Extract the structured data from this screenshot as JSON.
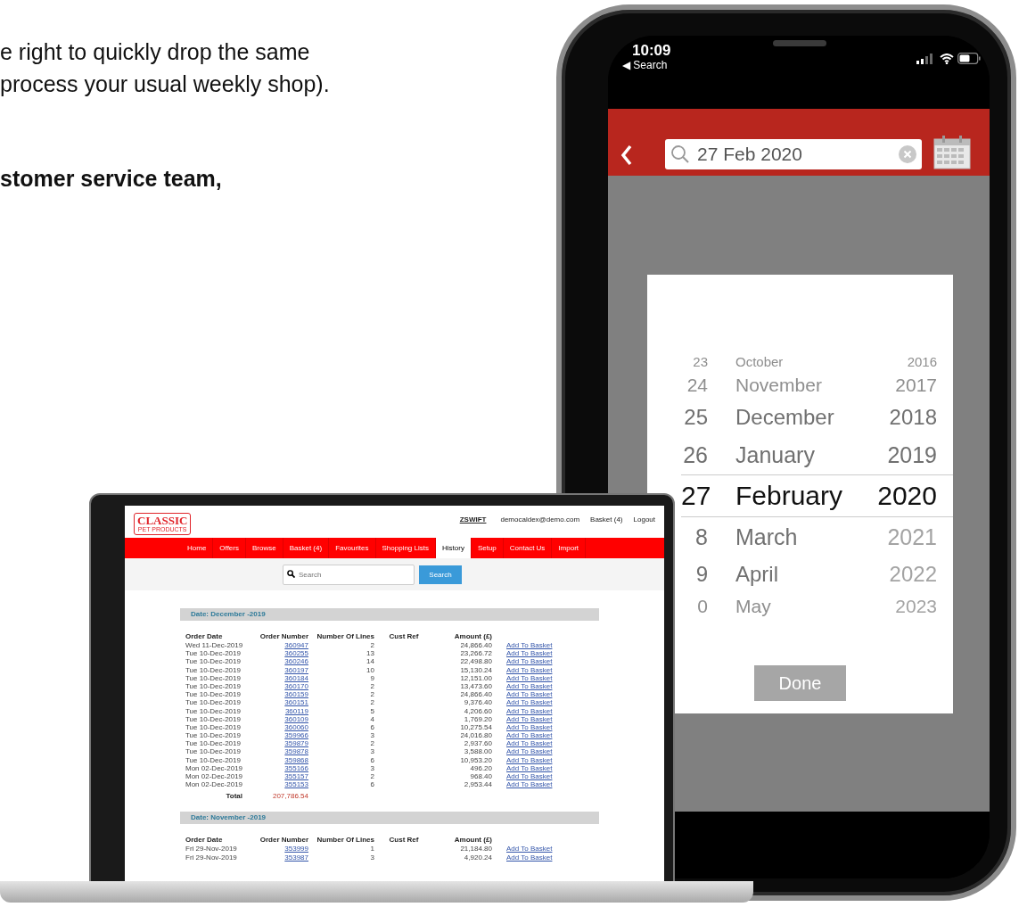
{
  "intro": {
    "lines": [
      "e right to quickly drop the same",
      "process your usual weekly shop)."
    ],
    "bold_line": "stomer service team,"
  },
  "laptop": {
    "logo": {
      "name": "CLASSIC",
      "tagline": "PET PRODUCTS"
    },
    "user": "ZSWIFT",
    "email": "democaldex@demo.com",
    "basket": "Basket (4)",
    "logout": "Logout",
    "nav": [
      {
        "label": "Home",
        "selected": false
      },
      {
        "label": "Offers",
        "selected": false
      },
      {
        "label": "Browse",
        "selected": false
      },
      {
        "label": "Basket (4)",
        "selected": false
      },
      {
        "label": "Favourites",
        "selected": false
      },
      {
        "label": "Shopping Lists",
        "selected": false
      },
      {
        "label": "History",
        "selected": true
      },
      {
        "label": "Setup",
        "selected": false
      },
      {
        "label": "Contact Us",
        "selected": false
      },
      {
        "label": "Import",
        "selected": false
      }
    ],
    "search": {
      "placeholder": "Search",
      "button": "Search"
    },
    "groups": [
      {
        "title": "Date:  December -2019",
        "columns": [
          "Order Date",
          "Order Number",
          "Number Of Lines",
          "Cust Ref",
          "Amount (£)"
        ],
        "rows": [
          {
            "date": "Wed 11-Dec-2019",
            "number": "360947",
            "lines": "2",
            "amount": "24,866.40",
            "action": "Add To Basket"
          },
          {
            "date": "Tue 10-Dec-2019",
            "number": "360255",
            "lines": "13",
            "amount": "23,266.72",
            "action": "Add To Basket"
          },
          {
            "date": "Tue 10-Dec-2019",
            "number": "360246",
            "lines": "14",
            "amount": "22,498.80",
            "action": "Add To Basket"
          },
          {
            "date": "Tue 10-Dec-2019",
            "number": "360197",
            "lines": "10",
            "amount": "15,130.24",
            "action": "Add To Basket"
          },
          {
            "date": "Tue 10-Dec-2019",
            "number": "360184",
            "lines": "9",
            "amount": "12,151.00",
            "action": "Add To Basket"
          },
          {
            "date": "Tue 10-Dec-2019",
            "number": "360170",
            "lines": "2",
            "amount": "13,473.60",
            "action": "Add To Basket"
          },
          {
            "date": "Tue 10-Dec-2019",
            "number": "360159",
            "lines": "2",
            "amount": "24,866.40",
            "action": "Add To Basket"
          },
          {
            "date": "Tue 10-Dec-2019",
            "number": "360151",
            "lines": "2",
            "amount": "9,376.40",
            "action": "Add To Basket"
          },
          {
            "date": "Tue 10-Dec-2019",
            "number": "360119",
            "lines": "5",
            "amount": "4,206.60",
            "action": "Add To Basket"
          },
          {
            "date": "Tue 10-Dec-2019",
            "number": "360109",
            "lines": "4",
            "amount": "1,769.20",
            "action": "Add To Basket"
          },
          {
            "date": "Tue 10-Dec-2019",
            "number": "360060",
            "lines": "6",
            "amount": "10,275.54",
            "action": "Add To Basket"
          },
          {
            "date": "Tue 10-Dec-2019",
            "number": "359966",
            "lines": "3",
            "amount": "24,016.80",
            "action": "Add To Basket"
          },
          {
            "date": "Tue 10-Dec-2019",
            "number": "359879",
            "lines": "2",
            "amount": "2,937.60",
            "action": "Add To Basket"
          },
          {
            "date": "Tue 10-Dec-2019",
            "number": "359878",
            "lines": "3",
            "amount": "3,588.00",
            "action": "Add To Basket"
          },
          {
            "date": "Tue 10-Dec-2019",
            "number": "359868",
            "lines": "6",
            "amount": "10,953.20",
            "action": "Add To Basket"
          },
          {
            "date": "Mon 02-Dec-2019",
            "number": "355166",
            "lines": "3",
            "amount": "496.20",
            "action": "Add To Basket"
          },
          {
            "date": "Mon 02-Dec-2019",
            "number": "355157",
            "lines": "2",
            "amount": "968.40",
            "action": "Add To Basket"
          },
          {
            "date": "Mon 02-Dec-2019",
            "number": "355153",
            "lines": "6",
            "amount": "2,953.44",
            "action": "Add To Basket"
          }
        ],
        "total_label": "Total",
        "total": "207,786.54"
      },
      {
        "title": "Date:  November -2019",
        "columns": [
          "Order Date",
          "Order Number",
          "Number Of Lines",
          "Cust Ref",
          "Amount (£)"
        ],
        "rows": [
          {
            "date": "Fri 29-Nov-2019",
            "number": "353999",
            "lines": "1",
            "amount": "21,184.80",
            "action": "Add To Basket"
          },
          {
            "date": "Fri 29-Nov-2019",
            "number": "353987",
            "lines": "3",
            "amount": "4,920.24",
            "action": "Add To Basket"
          }
        ]
      }
    ]
  },
  "phone": {
    "time": "10:09",
    "back_app": "◀ Search",
    "search_value": "27 Feb 2020",
    "picker": {
      "rows": [
        {
          "day": "23",
          "month": "October",
          "year": "2016",
          "selected": false,
          "year_disabled": false
        },
        {
          "day": "24",
          "month": "November",
          "year": "2017",
          "selected": false,
          "year_disabled": false
        },
        {
          "day": "25",
          "month": "December",
          "year": "2018",
          "selected": false,
          "year_disabled": false
        },
        {
          "day": "26",
          "month": "January",
          "year": "2019",
          "selected": false,
          "year_disabled": false
        },
        {
          "day": "27",
          "month": "February",
          "year": "2020",
          "selected": true,
          "year_disabled": false
        },
        {
          "day": "8",
          "month": "March",
          "year": "2021",
          "selected": false,
          "year_disabled": true
        },
        {
          "day": "9",
          "month": "April",
          "year": "2022",
          "selected": false,
          "year_disabled": true
        },
        {
          "day": "0",
          "month": "May",
          "year": "2023",
          "selected": false,
          "year_disabled": true
        }
      ],
      "done": "Done"
    }
  }
}
